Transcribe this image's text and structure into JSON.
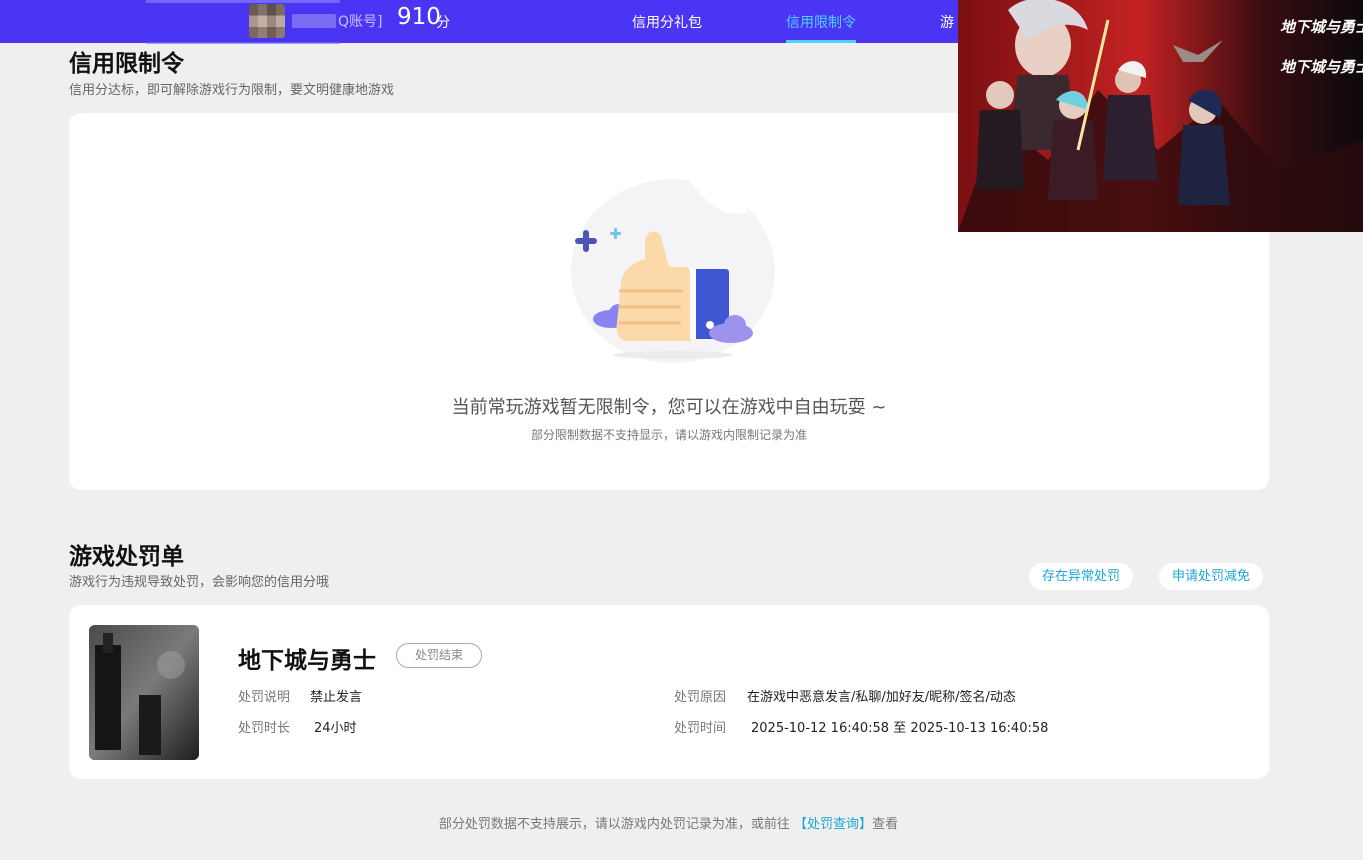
{
  "header": {
    "account_label": "Q账号]",
    "score": "910",
    "score_unit": "分",
    "nav": [
      "信用分礼包",
      "信用限制令",
      "游"
    ]
  },
  "restriction": {
    "title": "信用限制令",
    "subtitle": "信用分达标，即可解除游戏行为限制，要文明健康地游戏",
    "empty_main": "当前常玩游戏暂无限制令，您可以在游戏中自由玩耍 ~",
    "empty_sub": "部分限制数据不支持显示，请以游戏内限制记录为准"
  },
  "penalty": {
    "title": "游戏处罚单",
    "subtitle": "游戏行为违规导致处罚，会影响您的信用分哦",
    "btn_abnormal": "存在异常处罚",
    "btn_appeal": "申请处罚减免",
    "item": {
      "game": "地下城与勇士",
      "status": "处罚结束",
      "desc_label": "处罚说明",
      "desc_value": "禁止发言",
      "duration_label": "处罚时长",
      "duration_value": "24小时",
      "reason_label": "处罚原因",
      "reason_value": "在游戏中恶意发言/私聊/加好友/昵称/签名/动态",
      "time_label": "处罚时间",
      "time_value": "2025-10-12 16:40:58 至 2025-10-13 16:40:58"
    }
  },
  "footer": {
    "text_before": "部分处罚数据不支持展示，请以游戏内处罚记录为准，或前往 ",
    "link": "【处罚查询】",
    "text_after": "查看"
  },
  "ad": {
    "logo_1": "地下城与勇士",
    "logo_2": "地下城与勇士"
  },
  "icons": {
    "thumbs_up": "thumbs-up-illustration",
    "plus": "plus-sparkle-icon"
  },
  "colors": {
    "header_bg": "#4b35f5",
    "accent": "#4fd3ff",
    "link": "#1aa8d6"
  }
}
